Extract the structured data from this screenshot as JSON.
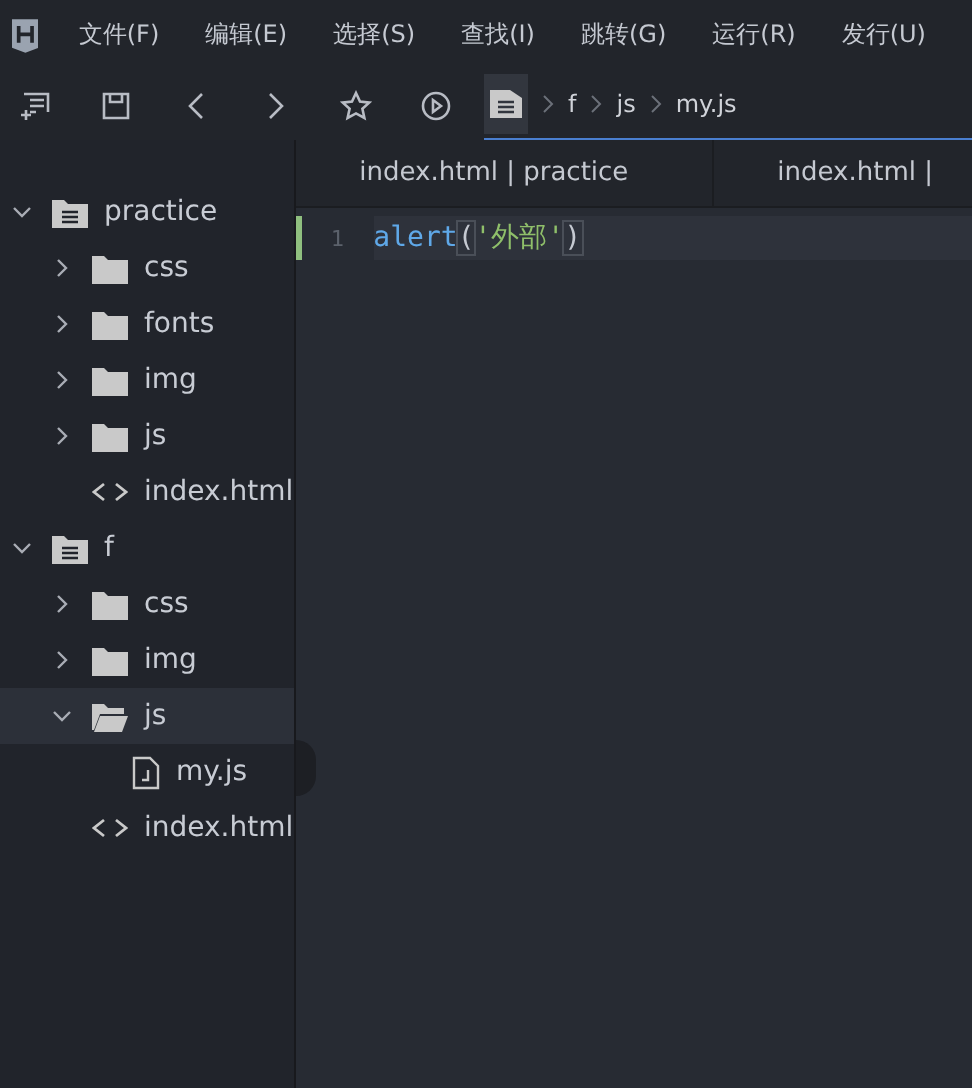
{
  "menu": [
    "文件(F)",
    "编辑(E)",
    "选择(S)",
    "查找(I)",
    "跳转(G)",
    "运行(R)",
    "发行(U)"
  ],
  "breadcrumb": [
    "f",
    "js",
    "my.js"
  ],
  "tree": [
    {
      "label": "practice",
      "kind": "project",
      "expanded": true,
      "selected": false,
      "children": [
        {
          "label": "css",
          "kind": "folder",
          "expanded": false,
          "selected": false
        },
        {
          "label": "fonts",
          "kind": "folder",
          "expanded": false,
          "selected": false
        },
        {
          "label": "img",
          "kind": "folder",
          "expanded": false,
          "selected": false
        },
        {
          "label": "js",
          "kind": "folder",
          "expanded": false,
          "selected": false
        },
        {
          "label": "index.html",
          "kind": "html",
          "selected": false
        }
      ]
    },
    {
      "label": "f",
      "kind": "project",
      "expanded": true,
      "selected": false,
      "children": [
        {
          "label": "css",
          "kind": "folder",
          "expanded": false,
          "selected": false
        },
        {
          "label": "img",
          "kind": "folder",
          "expanded": false,
          "selected": false
        },
        {
          "label": "js",
          "kind": "folder",
          "expanded": true,
          "selected": true,
          "children": [
            {
              "label": "my.js",
              "kind": "js",
              "selected": false
            }
          ]
        },
        {
          "label": "index.html",
          "kind": "html",
          "selected": false
        }
      ]
    }
  ],
  "tabs": [
    {
      "label": "index.html | practice",
      "selected": false
    },
    {
      "label": "index.html |",
      "selected": false
    }
  ],
  "code": [
    {
      "number": "1",
      "tokens": [
        {
          "text": "alert",
          "kind": "function"
        },
        {
          "text": "(",
          "kind": "bracket"
        },
        {
          "text": "'外部'",
          "kind": "string"
        },
        {
          "text": ")",
          "kind": "bracket"
        }
      ]
    }
  ]
}
